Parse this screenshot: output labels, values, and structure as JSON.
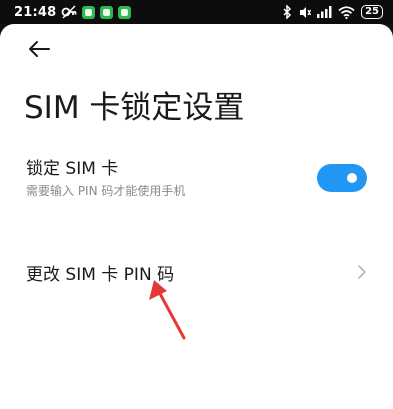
{
  "status_bar": {
    "time": "21:48",
    "battery": "25",
    "icons": [
      "vpn-key-icon",
      "app-notification-icon",
      "app-notification-icon",
      "app-notification-icon",
      "bluetooth-icon",
      "mute-icon",
      "signal-icon",
      "wifi-icon",
      "battery-icon"
    ]
  },
  "header": {
    "title": "SIM 卡锁定设置",
    "back_icon": "back-arrow-icon"
  },
  "settings": {
    "lock_sim": {
      "title": "锁定 SIM 卡",
      "subtitle": "需要输入 PIN 码才能使用手机",
      "enabled": true
    },
    "change_pin": {
      "title": "更改 SIM 卡 PIN 码"
    }
  },
  "colors": {
    "accent": "#2196f3",
    "annotation": "#e53935"
  }
}
